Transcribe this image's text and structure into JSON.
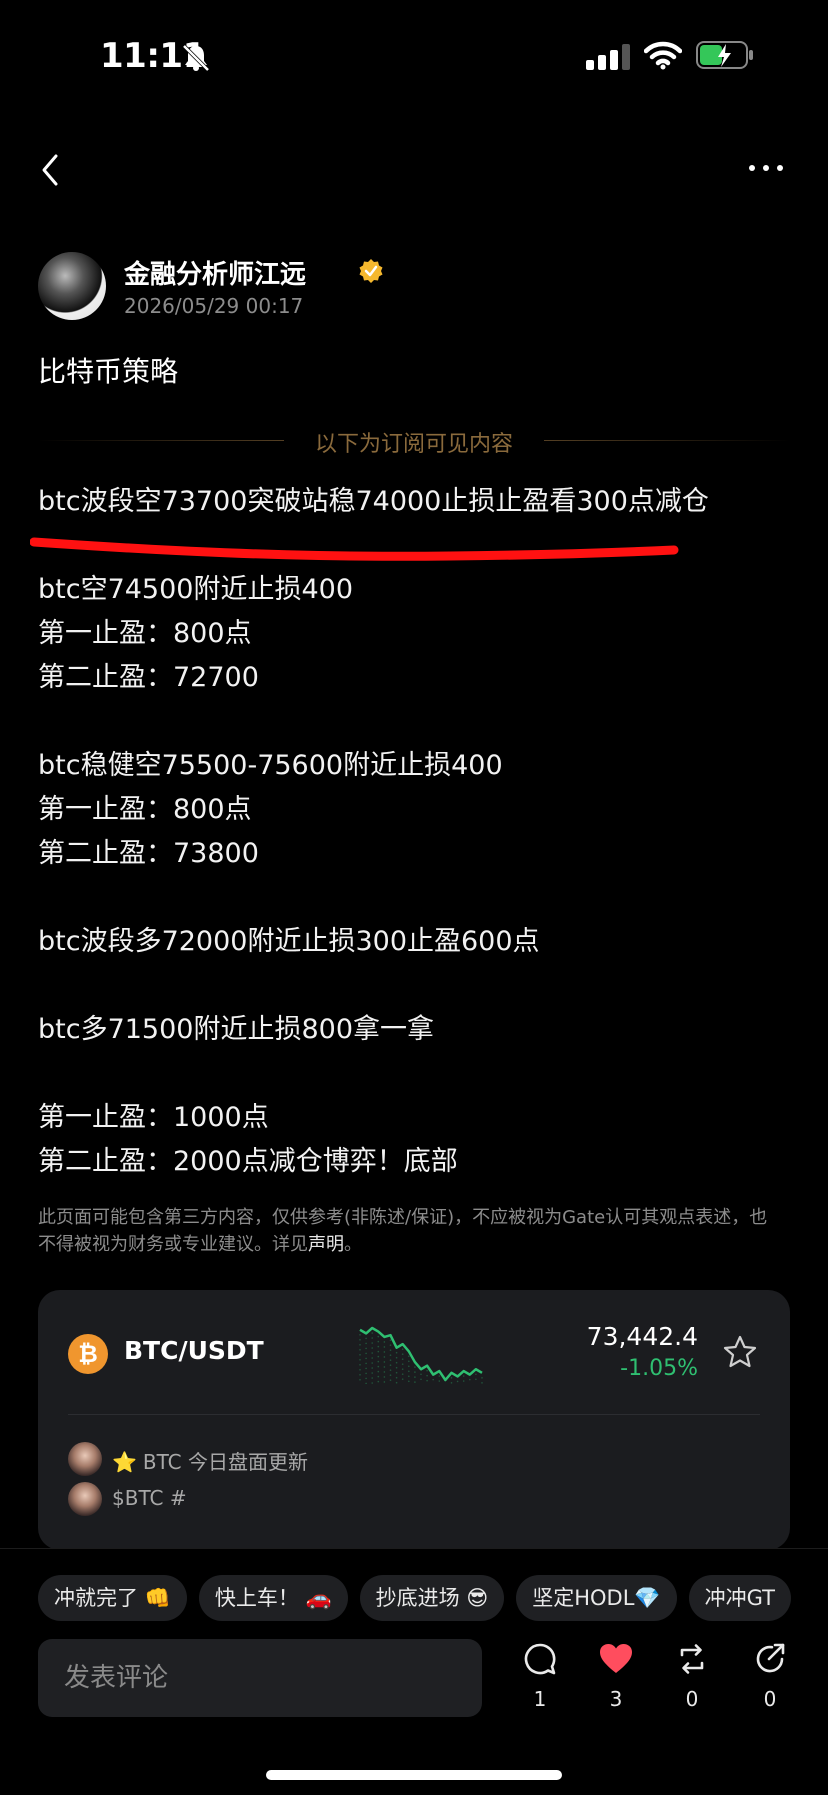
{
  "status_bar": {
    "time": "11:11"
  },
  "author": {
    "name": "金融分析师江远",
    "date": "2026/05/29 00:17"
  },
  "post": {
    "title": "比特币策略",
    "divider": "以下为订阅可见内容",
    "lines": [
      "btc波段空73700突破站稳74000止损止盈看300点减仓",
      "",
      "btc空74500附近止损400",
      "第一止盈：800点",
      "第二止盈：72700",
      "",
      "btc稳健空75500-75600附近止损400",
      "第一止盈：800点",
      "第二止盈：73800",
      "",
      "btc波段多72000附近止损300止盈600点",
      "",
      "btc多71500附近止损800拿一拿",
      "",
      "第一止盈：1000点",
      "第二止盈：2000点减仓博弈！底部"
    ],
    "disclaimer_text": "此页面可能包含第三方内容，仅供参考(非陈述/保证)，不应被视为Gate认可其观点表述，也不得被视为财务或专业建议。详见",
    "disclaimer_link": "声明",
    "disclaimer_end": "。"
  },
  "ticker": {
    "pair": "BTC/USDT",
    "coin_symbol": "₿",
    "price": "73,442.4",
    "change": "-1.05%",
    "change_color": "#2fbf71",
    "sparkline": [
      10,
      12,
      9,
      11,
      14,
      13,
      20,
      18,
      22,
      28,
      32,
      30,
      35,
      33,
      38,
      34,
      36,
      33,
      35,
      32,
      34
    ],
    "news": [
      {
        "star": "⭐",
        "text": "BTC 今日盘面更新"
      },
      {
        "star": "",
        "text": "$BTC #"
      }
    ]
  },
  "quick_replies": [
    "冲就完了 👊",
    "快上车！ 🚗",
    "抄底进场 😎",
    "坚定HODL💎",
    "冲冲GT"
  ],
  "comment": {
    "placeholder": "发表评论"
  },
  "actions": {
    "comments": "1",
    "likes": "3",
    "reposts": "0",
    "shares": "0",
    "like_color": "#ff4d5e"
  }
}
